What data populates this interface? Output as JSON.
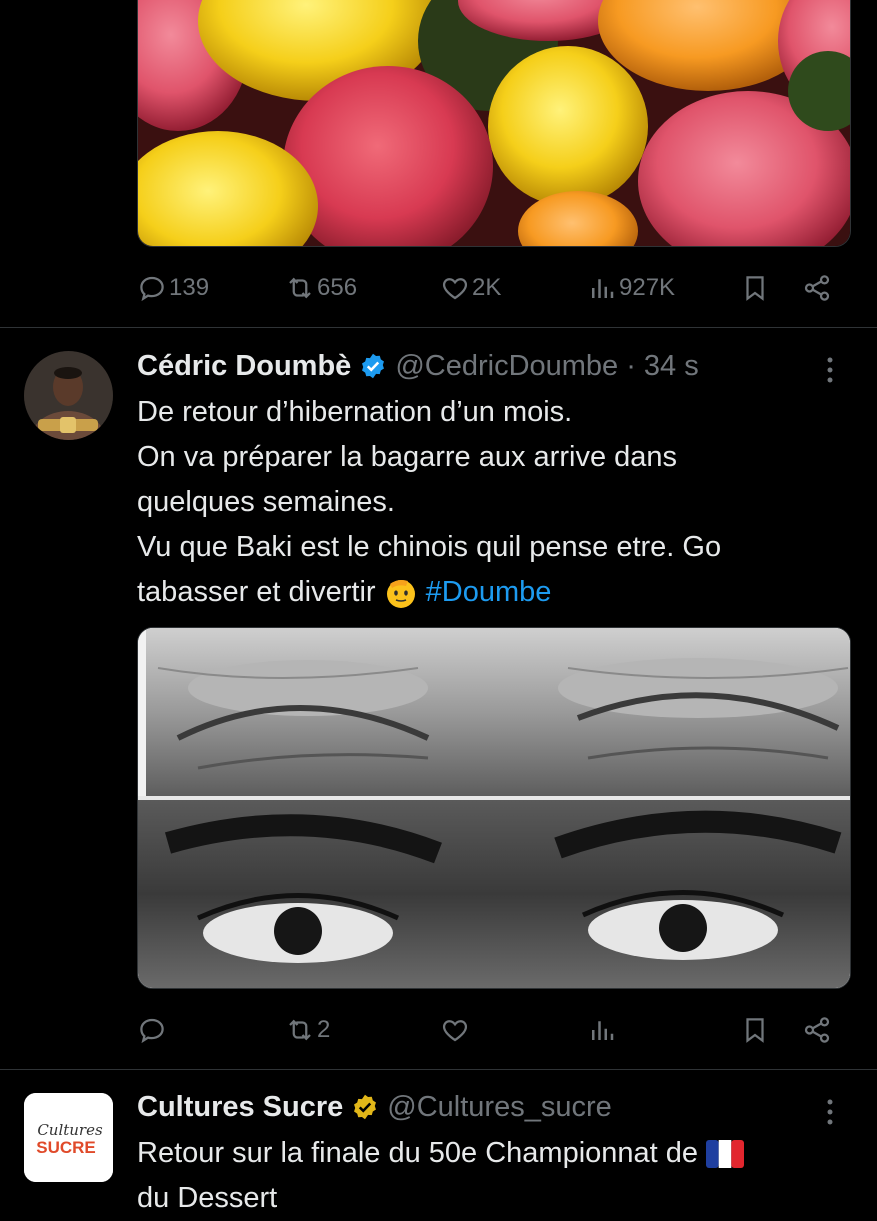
{
  "tweet_prev": {
    "media_alt": "candy",
    "actions": {
      "replies": "139",
      "retweets": "656",
      "likes": "2K",
      "views": "927K"
    }
  },
  "tweet_main": {
    "author_name": "Cédric Doumbè",
    "handle": "@CedricDoumbe",
    "time": "· 34 s",
    "text_lines": [
      "De retour d’hibernation d’un mois.",
      "On va préparer la bagarre aux arrive dans",
      "quelques semaines.",
      "Vu que Baki est le chinois quil pense etre. Go",
      "tabasser et divertir"
    ],
    "hashtag": "#Doumbe",
    "actions": {
      "replies": "",
      "retweets": "2",
      "likes": "",
      "views": ""
    }
  },
  "tweet_next": {
    "author_name": "Cultures Sucre",
    "handle": "@Cultures_sucre",
    "avatar_logo_text": "Cultures SUCRE",
    "text_lines": [
      "Retour sur la finale du 50e Championnat de",
      "du Dessert"
    ]
  },
  "colors": {
    "background": "#000000",
    "text": "#e7e9ea",
    "muted": "#71767b",
    "link": "#1d9bf0",
    "verified_blue": "#1d9bf0",
    "verified_gold": "#e2b719"
  }
}
